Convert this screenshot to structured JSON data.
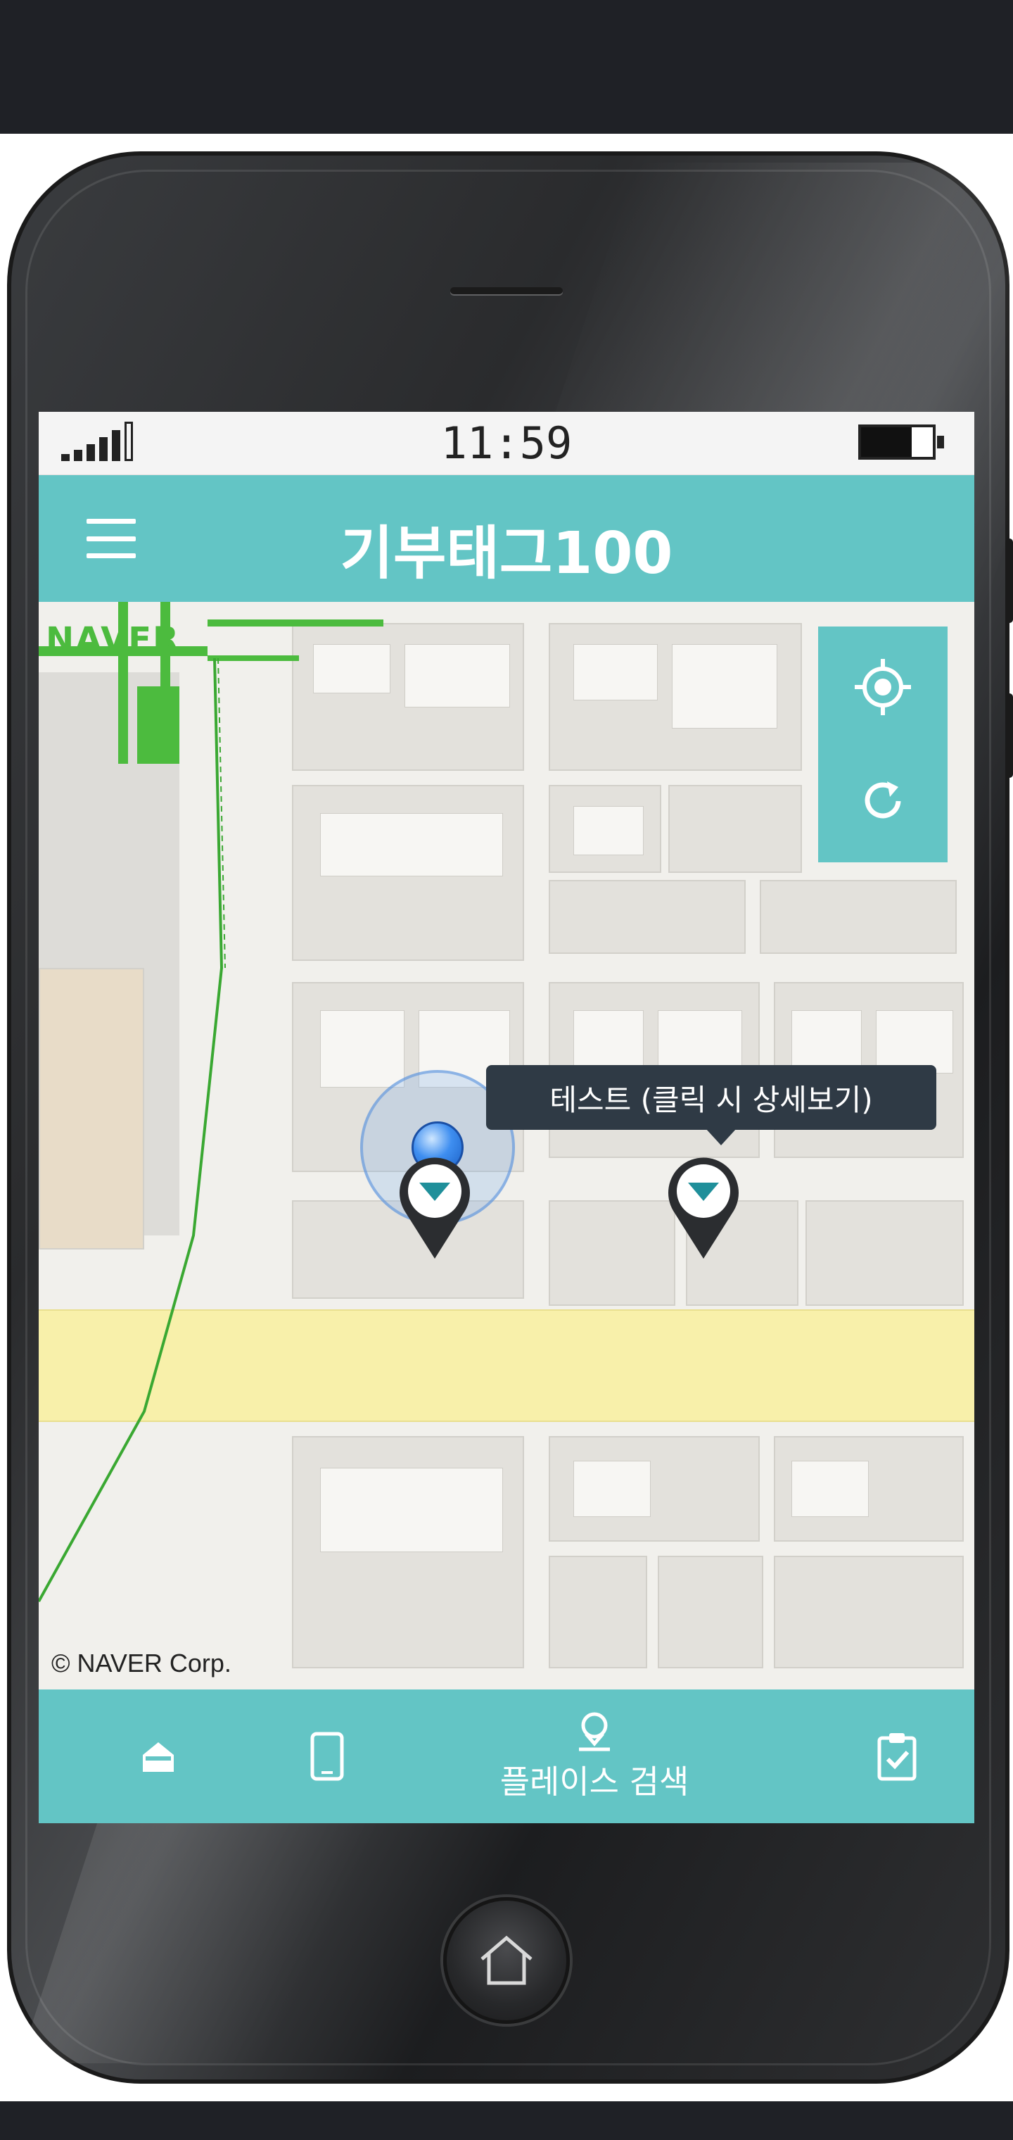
{
  "status_bar": {
    "time": "11:59"
  },
  "app_bar": {
    "title": "기부태그100",
    "menu_icon": "hamburger-menu-icon"
  },
  "map": {
    "provider_logo": "NAVER",
    "credit": "© NAVER Corp.",
    "controls": [
      {
        "name": "current-location",
        "icon": "crosshair-icon"
      },
      {
        "name": "refresh",
        "icon": "refresh-icon"
      }
    ],
    "tooltip": "테스트 (클릭 시 상세보기)",
    "markers": [
      "place-marker",
      "place-marker"
    ]
  },
  "bottom_nav": {
    "items": [
      {
        "icon": "home-icon",
        "label": ""
      },
      {
        "icon": "phone-icon",
        "label": ""
      },
      {
        "icon": "location-pin-icon",
        "label": "플레이스 검색"
      },
      {
        "icon": "clipboard-check-icon",
        "label": ""
      }
    ]
  },
  "colors": {
    "accent": "#63c5c5",
    "tooltip_bg": "#2f3a45",
    "map_route": "#4cbb3e",
    "yellow_road": "#f8f0aa"
  }
}
